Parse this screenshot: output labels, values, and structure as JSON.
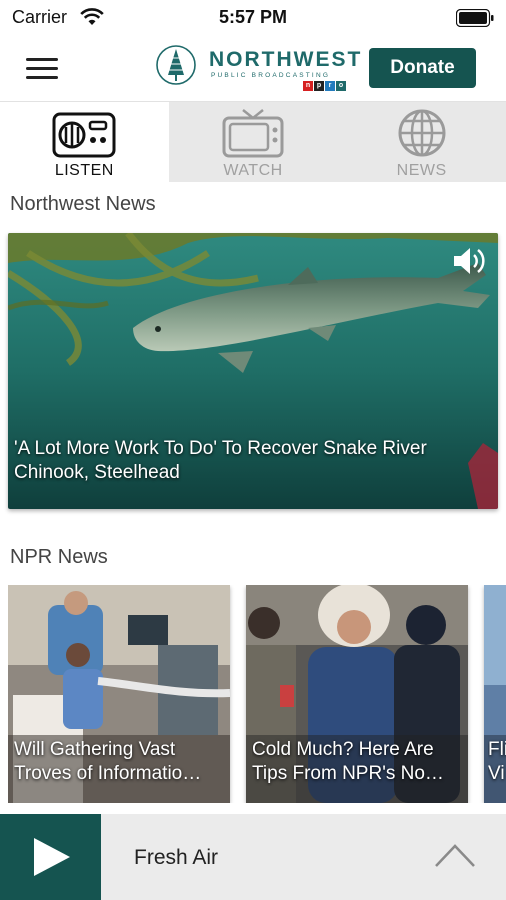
{
  "status_bar": {
    "carrier": "Carrier",
    "time": "5:57 PM",
    "icons": [
      "wifi-icon",
      "battery-icon"
    ]
  },
  "header": {
    "menu_icon": "hamburger-menu-icon",
    "logo": {
      "title": "NORTHWEST",
      "subtitle": "PUBLIC BROADCASTING",
      "badge": [
        "n",
        "p",
        "r",
        "o"
      ]
    },
    "donate_label": "Donate"
  },
  "tabs": [
    {
      "label": "LISTEN",
      "icon": "radio-icon",
      "active": true
    },
    {
      "label": "WATCH",
      "icon": "tv-icon",
      "active": false
    },
    {
      "label": "NEWS",
      "icon": "globe-icon",
      "active": false
    }
  ],
  "northwest_news": {
    "title": "Northwest News",
    "featured": {
      "headline_line1": "'A Lot More Work To Do' To Recover Snake River",
      "headline_line2": "Chinook, Steelhead",
      "audio_icon": "speaker-icon"
    }
  },
  "npr_news": {
    "title": "NPR News",
    "cards": [
      {
        "line1": "Will Gathering Vast",
        "line2": "Troves of Informatio…"
      },
      {
        "line1": "Cold Much? Here Are",
        "line2": "Tips From NPR's No…"
      },
      {
        "line1": "Fli",
        "line2": "Vi"
      }
    ]
  },
  "player": {
    "now_playing": "Fresh Air",
    "play_icon": "play-icon",
    "expand_icon": "chevron-up-icon"
  },
  "colors": {
    "brand": "#155450",
    "logo_text": "#1f6a6a",
    "tab_inactive_bg": "#e8e8e8",
    "player_bg": "#ebebeb"
  }
}
